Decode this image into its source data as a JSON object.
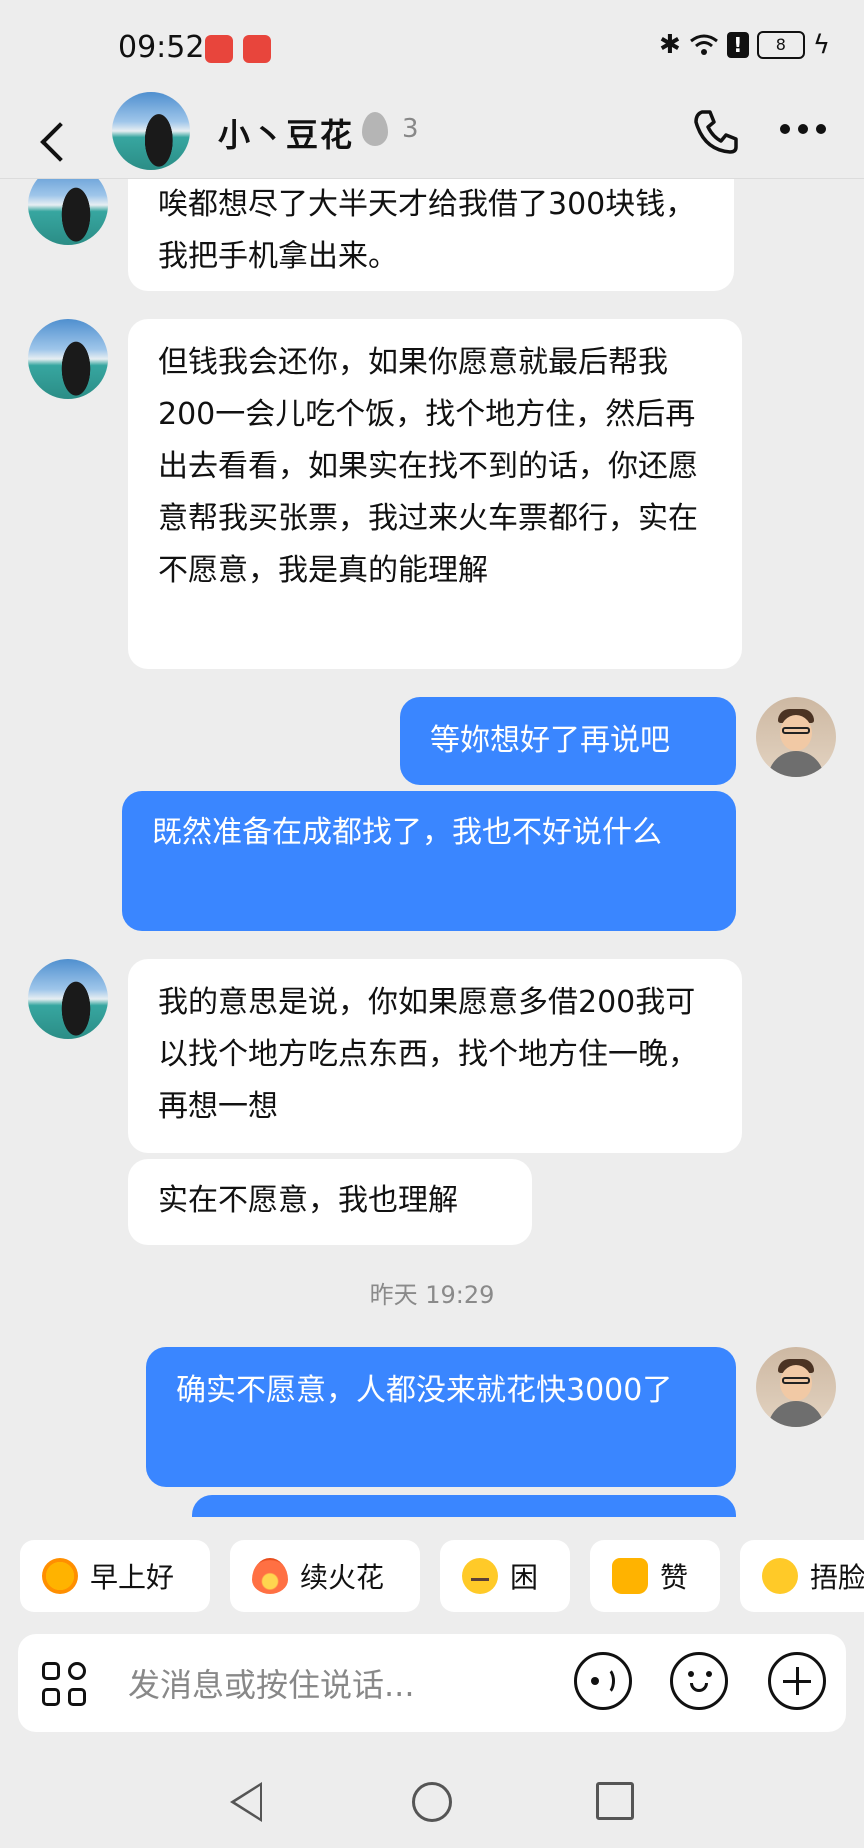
{
  "status_bar": {
    "time": "09:52",
    "battery": "8",
    "icons": [
      "bluetooth-icon",
      "wifi-icon",
      "alert-icon",
      "battery-icon",
      "charging-icon"
    ]
  },
  "header": {
    "contact_name": "小丶豆花",
    "streak_count": "3"
  },
  "messages": [
    {
      "side": "in",
      "text": "唉都想尽了大半天才给我借了300块钱，我把手机拿出来。"
    },
    {
      "side": "in",
      "text": "但钱我会还你，如果你愿意就最后帮我200一会儿吃个饭，找个地方住，然后再出去看看，如果实在找不到的话，你还愿意帮我买张票，我过来火车票都行，实在不愿意，我是真的能理解"
    },
    {
      "side": "out",
      "text": "等妳想好了再说吧"
    },
    {
      "side": "out",
      "text": "既然准备在成都找了，我也不好说什么"
    },
    {
      "side": "in",
      "text": "我的意思是说，你如果愿意多借200我可以找个地方吃点东西，找个地方住一晚，再想一想"
    },
    {
      "side": "in",
      "text": "实在不愿意，我也理解"
    },
    {
      "side": "out",
      "text": "确实不愿意，人都没来就花快3000了"
    }
  ],
  "timestamp": "昨天 19:29",
  "quick_replies": [
    {
      "label": "早上好",
      "icon": "sun-sunglasses-icon"
    },
    {
      "label": "续火花",
      "icon": "fire-icon"
    },
    {
      "label": "困",
      "icon": "sleepy-face-icon"
    },
    {
      "label": "赞",
      "icon": "thumbs-up-icon"
    },
    {
      "label": "捂脸",
      "icon": "laugh-cry-icon"
    }
  ],
  "input": {
    "placeholder": "发消息或按住说话..."
  },
  "colors": {
    "outgoing_bubble": "#3a86ff",
    "incoming_bubble": "#ffffff",
    "background": "#ededed"
  }
}
